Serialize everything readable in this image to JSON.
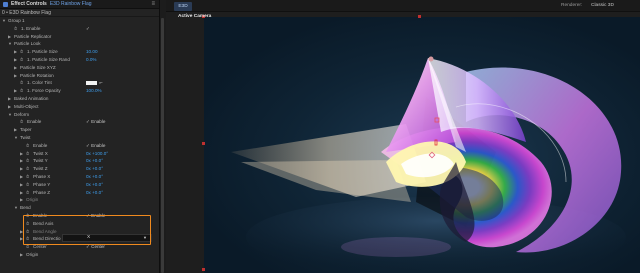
{
  "effect_controls": {
    "tab_title": "Effect Controls",
    "layer_name": "E3D Rainbow Flag",
    "panel_menu_glyph": "≡",
    "source_line": "0 • E3D Rainbow Flag",
    "rows": [
      {
        "label": "Group 1",
        "tri": "▼"
      },
      {
        "label": "1. Enable",
        "stopwatch": true,
        "value": "✓",
        "value_kind": "text"
      },
      {
        "label": "Particle Replicator",
        "tri": "▶"
      },
      {
        "label": "Particle Look",
        "tri": "▼"
      },
      {
        "label": "1. Particle Size",
        "tri": "▶",
        "stopwatch": true,
        "value": "10.00"
      },
      {
        "label": "1. Particle Size Rand",
        "tri": "▶",
        "stopwatch": true,
        "value": "0.0%"
      },
      {
        "label": "Particle Size XYZ",
        "tri": "▶"
      },
      {
        "label": "Particle Rotation",
        "tri": "▶"
      },
      {
        "label": "1. Color Tint",
        "stopwatch": true,
        "value_kind": "color"
      },
      {
        "label": "1. Force Opacity",
        "tri": "▶",
        "stopwatch": true,
        "value": "100.0%"
      },
      {
        "label": "Baked Animation",
        "tri": "▶"
      },
      {
        "label": "Multi-Object",
        "tri": "▶"
      },
      {
        "label": "Deform",
        "tri": "▼"
      },
      {
        "label": "Enable",
        "stopwatch": true,
        "value": "✓  Enable",
        "value_kind": "text"
      },
      {
        "label": "Taper",
        "tri": "▶"
      },
      {
        "label": "Twist",
        "tri": "▼"
      },
      {
        "label": "Enable",
        "stopwatch": true,
        "value": "✓  Enable",
        "value_kind": "text"
      },
      {
        "label": "Twist X",
        "tri": "▶",
        "stopwatch": true,
        "value": "0x +100.0°"
      },
      {
        "label": "Twist Y",
        "tri": "▶",
        "stopwatch": true,
        "value": "0x +0.0°"
      },
      {
        "label": "Twist Z",
        "tri": "▶",
        "stopwatch": true,
        "value": "0x +0.0°"
      },
      {
        "label": "Phase X",
        "tri": "▶",
        "stopwatch": true,
        "value": "0x +0.0°"
      },
      {
        "label": "Phase Y",
        "tri": "▶",
        "stopwatch": true,
        "value": "0x +0.0°"
      },
      {
        "label": "Phase Z",
        "tri": "▶",
        "stopwatch": true,
        "value": "0x +0.0°"
      },
      {
        "label": "Origin",
        "tri": "▶",
        "dim": true
      },
      {
        "label": "Bend",
        "tri": "▼"
      },
      {
        "label": "Enable",
        "stopwatch": true,
        "value": "✓  Enable",
        "value_kind": "text"
      },
      {
        "label": "Bend Axis",
        "stopwatch": true,
        "value": "",
        "value_kind": "text"
      },
      {
        "label": "Bend Angle",
        "tri": "▶",
        "stopwatch": true,
        "value": "",
        "dim": true
      },
      {
        "label": "Bend Directio",
        "tri": "▶",
        "stopwatch": true,
        "value": "0x +90.0°"
      },
      {
        "label": "Center",
        "stopwatch": true,
        "value": "✓  Center",
        "value_kind": "text"
      },
      {
        "label": "Origin",
        "tri": "▶"
      }
    ],
    "bend_axis_dropdown": {
      "value": "X"
    },
    "highlight_color": "#f08a1e",
    "value_color": "#3fa0f0"
  },
  "composition": {
    "tab_label": "E3D",
    "renderer_label": "Renderer:",
    "renderer_value": "Classic 3D",
    "camera_label": "Active Camera"
  }
}
